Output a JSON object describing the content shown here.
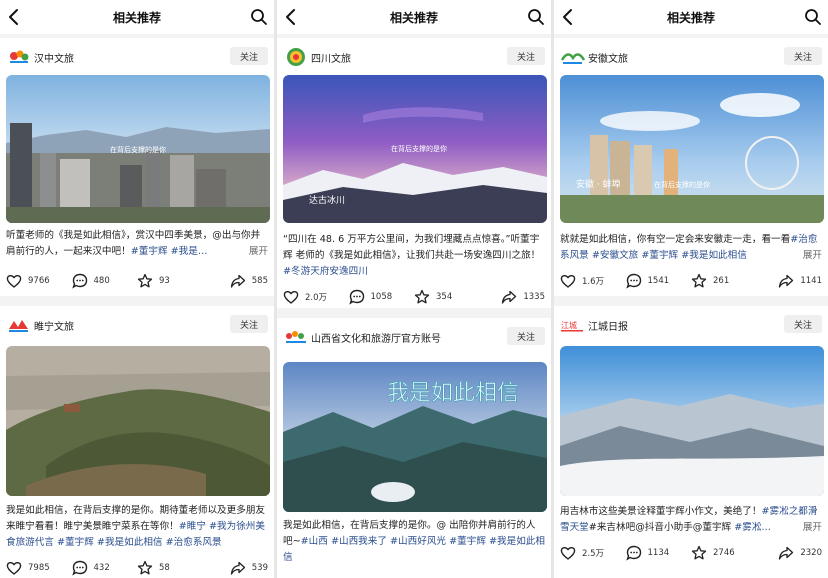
{
  "panes": [
    {
      "title": "相关推荐",
      "cards": [
        {
          "account": "汉中文旅",
          "follow": "关注",
          "overlay": "在背后支撑的是你",
          "caption": [
            {
              "t": "听董老师的《我是如此相信》，赏汉中四季美景，@出与你并肩前行的人，一起来汉中吧！"
            },
            {
              "t": "#董宇辉",
              "tag": true
            },
            {
              "t": " "
            },
            {
              "t": "#我是…",
              "tag": true
            }
          ],
          "more": "展开",
          "likes": "9766",
          "comments": "480",
          "stars": "93",
          "shares": "585"
        },
        {
          "account": "睢宁文旅",
          "follow": "关注",
          "caption": [
            {
              "t": "我是如此相信，在背后支撑的是你。期待董老师以及更多朋友来睢宁看看！睢宁美景睢宁菜系在等你！"
            },
            {
              "t": "#睢宁",
              "tag": true
            },
            {
              "t": " "
            },
            {
              "t": "#我为徐州美食旅游代言",
              "tag": true
            },
            {
              "t": " "
            },
            {
              "t": "#董宇辉",
              "tag": true
            },
            {
              "t": " "
            },
            {
              "t": "#我是如此相信",
              "tag": true
            },
            {
              "t": " "
            },
            {
              "t": "#治愈系风景",
              "tag": true
            }
          ],
          "likes": "7985",
          "comments": "432",
          "stars": "58",
          "shares": "539"
        }
      ]
    },
    {
      "title": "相关推荐",
      "cards": [
        {
          "account": "四川文旅",
          "follow": "关注",
          "overlay": "在背后支撑的是你",
          "overlay2": "达古冰川",
          "caption": [
            {
              "t": "“四川在 48. 6 万平方公里间，为我们埋藏点点惊喜。”听董宇辉 老师的《我是如此相信》，让我们共赴一场安逸四川之旅！"
            },
            {
              "t": "#冬游天府安逸四川",
              "tag": true
            }
          ],
          "likes": "2.0万",
          "comments": "1058",
          "stars": "354",
          "shares": "1335"
        },
        {
          "account": "山西省文化和旅游厅官方账号",
          "follow": "关注",
          "overlay": "我是如此相信",
          "caption": [
            {
              "t": "我是如此相信，在背后支撑的是你。@ 出陪你并肩前行的人吧~"
            },
            {
              "t": "#山西",
              "tag": true
            },
            {
              "t": " "
            },
            {
              "t": "#山西我来了",
              "tag": true
            },
            {
              "t": " "
            },
            {
              "t": "#山西好风光",
              "tag": true
            },
            {
              "t": " "
            },
            {
              "t": "#董宇辉",
              "tag": true
            },
            {
              "t": " "
            },
            {
              "t": "#我是如此相信",
              "tag": true
            }
          ]
        }
      ]
    },
    {
      "title": "相关推荐",
      "cards": [
        {
          "account": "安徽文旅",
          "follow": "关注",
          "overlay": "安徽 · 蚌埠",
          "overlay2": "在背后支撑的是你",
          "caption": [
            {
              "t": "就就是如此相信，你有空一定会来安徽走一走，看一看"
            },
            {
              "t": "#治愈系风景",
              "tag": true
            },
            {
              "t": " "
            },
            {
              "t": "#安徽文旅",
              "tag": true
            },
            {
              "t": " "
            },
            {
              "t": "#董宇辉",
              "tag": true
            },
            {
              "t": " "
            },
            {
              "t": "#我是如此相信",
              "tag": true
            },
            {
              "t": " "
            }
          ],
          "more": "展开",
          "likes": "1.6万",
          "comments": "1541",
          "stars": "261",
          "shares": "1141"
        },
        {
          "account": "江城日报",
          "follow": "关注",
          "caption": [
            {
              "t": "用吉林市这些美景诠释董宇辉小作文，美绝了！"
            },
            {
              "t": "#雾凇之都滑雪天堂",
              "tag": true
            },
            {
              "t": "#来吉林吧@抖音小助手@董宇辉 "
            },
            {
              "t": "#雾凇…",
              "tag": true
            }
          ],
          "more": "展开",
          "likes": "2.5万",
          "comments": "1134",
          "stars": "2746",
          "shares": "2320"
        }
      ]
    }
  ]
}
